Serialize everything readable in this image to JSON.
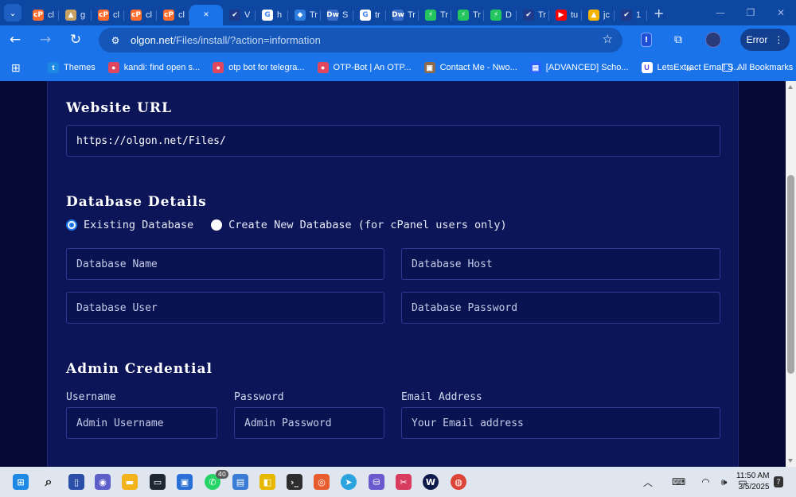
{
  "browser": {
    "tabs": [
      {
        "favicon": "cpanel-icon",
        "label": "cl",
        "color": "#ff6c2c",
        "glyph": "cP"
      },
      {
        "favicon": "triangle-icon",
        "label": "g",
        "color": "#c8a060",
        "glyph": "▲"
      },
      {
        "favicon": "cpanel-icon",
        "label": "cl",
        "color": "#ff6c2c",
        "glyph": "cP"
      },
      {
        "favicon": "cpanel-icon",
        "label": "cl",
        "color": "#ff6c2c",
        "glyph": "cP"
      },
      {
        "favicon": "cpanel-icon",
        "label": "cl",
        "color": "#ff6c2c",
        "glyph": "cP"
      },
      {
        "favicon": "close-icon",
        "label": "",
        "color": "#1a73e8",
        "glyph": "✕",
        "active": true
      },
      {
        "favicon": "check-icon",
        "label": "V",
        "color": "#1e3a8a",
        "glyph": "✔"
      },
      {
        "favicon": "google-icon",
        "label": "h",
        "color": "#ffffff",
        "glyph": "G"
      },
      {
        "favicon": "cube-icon",
        "label": "Tr",
        "color": "#2f7de1",
        "glyph": "◆"
      },
      {
        "favicon": "dw-icon",
        "label": "S",
        "color": "#3b6cc7",
        "glyph": "Dw"
      },
      {
        "favicon": "google-icon",
        "label": "tr",
        "color": "#ffffff",
        "glyph": "G"
      },
      {
        "favicon": "dw-icon",
        "label": "Tr",
        "color": "#3b6cc7",
        "glyph": "Dw"
      },
      {
        "favicon": "bolt-icon",
        "label": "Tr",
        "color": "#22c55e",
        "glyph": "⚡"
      },
      {
        "favicon": "bolt-icon",
        "label": "Tr",
        "color": "#22c55e",
        "glyph": "⚡"
      },
      {
        "favicon": "bolt-icon",
        "label": "D",
        "color": "#22c55e",
        "glyph": "⚡"
      },
      {
        "favicon": "check-icon",
        "label": "Tr",
        "color": "#1e3a8a",
        "glyph": "✔"
      },
      {
        "favicon": "youtube-icon",
        "label": "tu",
        "color": "#ff0000",
        "glyph": "▶"
      },
      {
        "favicon": "drive-icon",
        "label": "jc",
        "color": "#f4b400",
        "glyph": "▲"
      },
      {
        "favicon": "check-icon",
        "label": "1",
        "color": "#1e3a8a",
        "glyph": "✔"
      }
    ],
    "url_host": "olgon.net",
    "url_rest": "/Files/install/?action=information",
    "error_label": "Error",
    "bookmarks": [
      {
        "label": "Themes",
        "icon": "t-icon",
        "color": "#1e88e5",
        "glyph": "t"
      },
      {
        "label": "kandi: find open s...",
        "icon": "kandi-icon",
        "color": "#e0475f",
        "glyph": "●"
      },
      {
        "label": "otp bot for telegra...",
        "icon": "kandi-icon",
        "color": "#e0475f",
        "glyph": "●"
      },
      {
        "label": "OTP-Bot | An OTP...",
        "icon": "kandi-icon",
        "color": "#e0475f",
        "glyph": "●"
      },
      {
        "label": "Contact Me - Nwo...",
        "icon": "contact-icon",
        "color": "#8b6b4a",
        "glyph": "▣"
      },
      {
        "label": "[ADVANCED] Scho...",
        "icon": "doc-icon",
        "color": "#2962ff",
        "glyph": "▤"
      },
      {
        "label": "LetsExtract Email S...",
        "icon": "u-icon",
        "color": "#ffffff",
        "glyph": "U"
      }
    ],
    "all_bookmarks_label": "All Bookmarks"
  },
  "form": {
    "website_url_heading": "Website URL",
    "website_url_value": "https://olgon.net/Files/",
    "database_heading": "Database Details",
    "radio_existing": "Existing Database",
    "radio_create": "Create New Database (for cPanel users only)",
    "db_name_placeholder": "Database Name",
    "db_host_placeholder": "Database Host",
    "db_user_placeholder": "Database User",
    "db_password_placeholder": "Database Password",
    "admin_heading": "Admin Credential",
    "username_label": "Username",
    "password_label": "Password",
    "email_label": "Email Address",
    "username_placeholder": "Admin Username",
    "password_placeholder": "Admin Password",
    "email_placeholder": "Your Email address"
  },
  "taskbar": {
    "whatsapp_badge": "40",
    "time": "11:50 AM",
    "date": "3/5/2025",
    "notifications": "7"
  }
}
